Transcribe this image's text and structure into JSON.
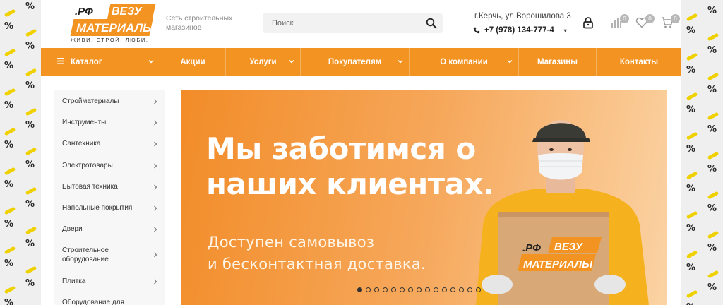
{
  "logo": {
    "rf": ".РФ",
    "line1": "ВЕЗУ",
    "line2": "МАТЕРИАЛЫ",
    "slogan": "ЖИВИ. СТРОЙ. ЛЮБИ."
  },
  "header": {
    "tagline": "Сеть строительных магазинов",
    "search_placeholder": "Поиск",
    "address": "г.Керчь, ул.Ворошилова 3",
    "phone": "+7 (978) 134-777-4",
    "compare_count": "0",
    "favorites_count": "0",
    "cart_count": "0"
  },
  "menu": {
    "items": [
      {
        "label": "Каталог",
        "dropdown": true
      },
      {
        "label": "Акции",
        "dropdown": false
      },
      {
        "label": "Услуги",
        "dropdown": true
      },
      {
        "label": "Покупателям",
        "dropdown": true
      },
      {
        "label": "О компании",
        "dropdown": true
      },
      {
        "label": "Магазины",
        "dropdown": false
      },
      {
        "label": "Контакты",
        "dropdown": false
      }
    ]
  },
  "sidebar": {
    "items": [
      {
        "label": "Стройматериалы"
      },
      {
        "label": "Инструменты"
      },
      {
        "label": "Сантехника"
      },
      {
        "label": "Электротовары"
      },
      {
        "label": "Бытовая техника"
      },
      {
        "label": "Напольные покрытия"
      },
      {
        "label": "Двери"
      },
      {
        "label": "Строительное оборудование"
      },
      {
        "label": "Плитка"
      },
      {
        "label": "Оборудование для"
      }
    ]
  },
  "banner": {
    "headline_line1": "Мы заботимся о",
    "headline_line2": "наших клиентах.",
    "sub_line1": "Доступен самовывоз",
    "sub_line2": "и бесконтактная доставка.",
    "box_logo_rf": ".РФ",
    "box_logo_line1": "ВЕЗУ",
    "box_logo_line2": "МАТЕРИАЛЫ",
    "slide_count": 15,
    "active_slide": 1
  },
  "colors": {
    "accent": "#f39322",
    "accent_dark": "#e5801a"
  }
}
